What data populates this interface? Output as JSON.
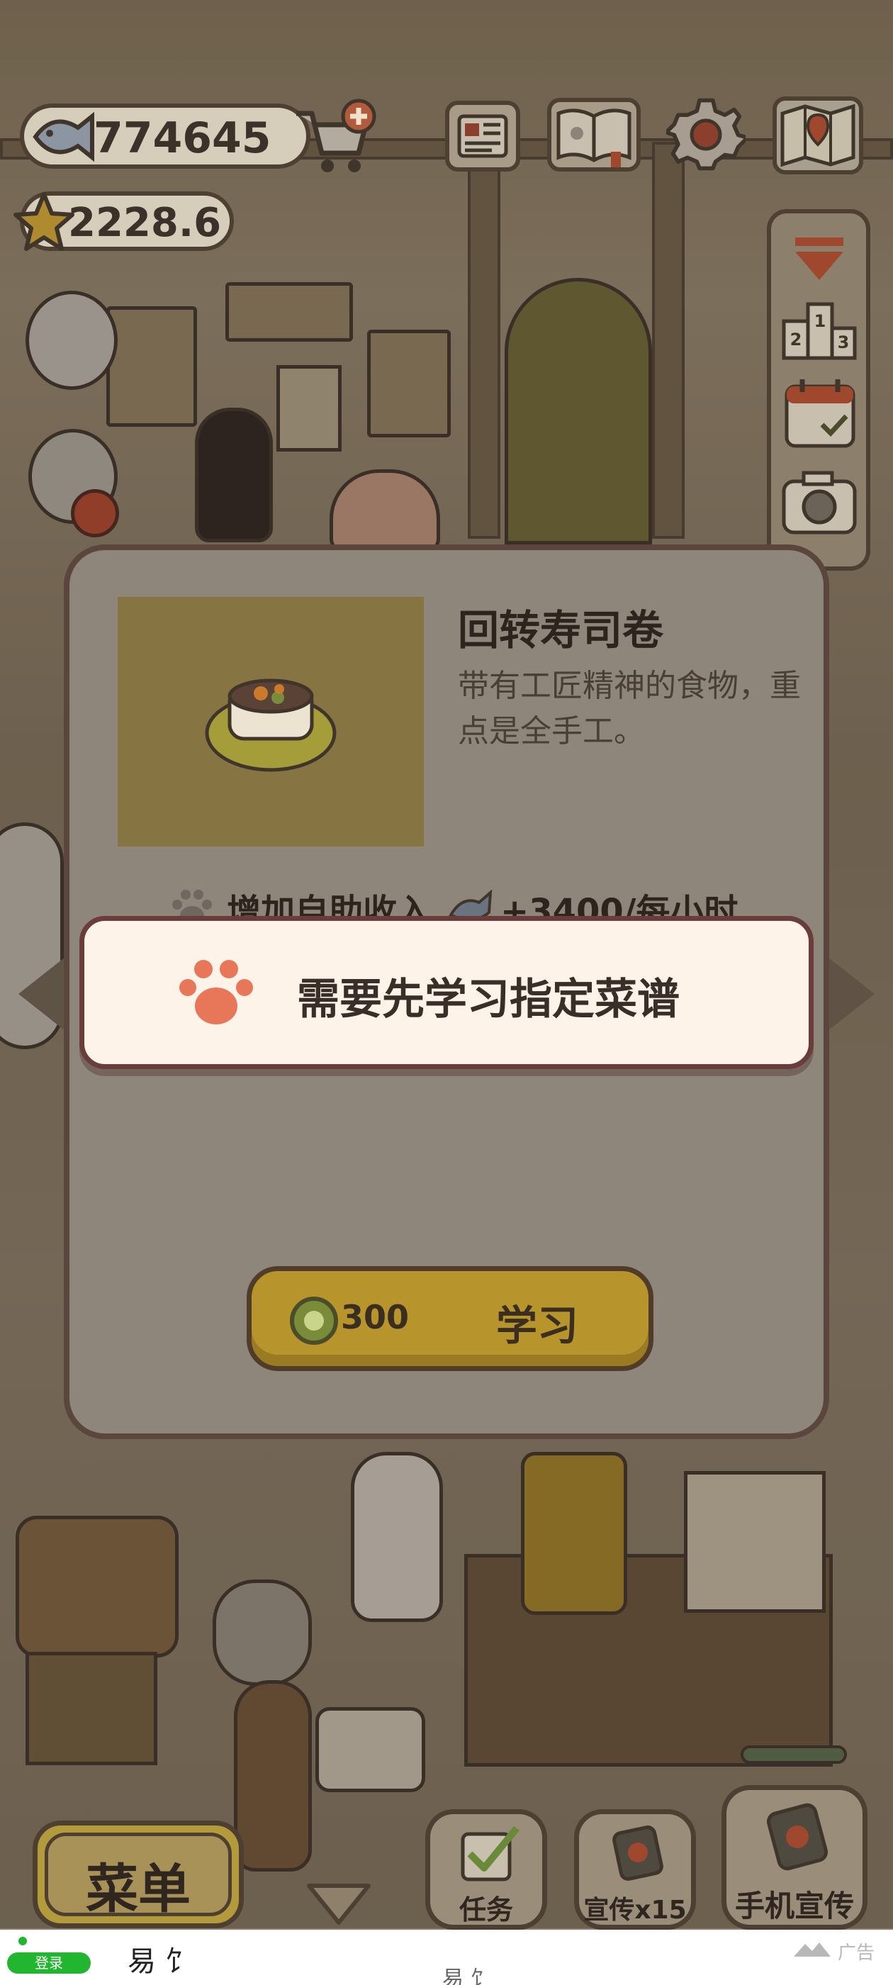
{
  "hud": {
    "fish": "774645",
    "stars": "2228.6",
    "icons": [
      "fish-icon",
      "cart-plus-icon",
      "newspaper-icon",
      "recipe-book-icon",
      "gear-icon",
      "map-icon",
      "star-icon"
    ],
    "side_icons": [
      "chevron-down-icon",
      "podium-icon",
      "calendar-icon",
      "camera-icon"
    ]
  },
  "dialog": {
    "dish_name": "回转寿司卷",
    "description": "带有工匠精神的食物，重点是全手工。",
    "income_label": "增加自助收入",
    "income_value": "+3400/每小时",
    "cost": "300",
    "learn_label": "学习"
  },
  "toast": {
    "message": "需要先学习指定菜谱"
  },
  "bottom": {
    "menu_label": "菜单",
    "task_label": "任务",
    "promo_label": "宣传x15",
    "phone_promo_label": "手机宣传"
  },
  "ad": {
    "login_label": "登录",
    "brand": "易 饣",
    "brand_sub": "易 饣",
    "tag": "广告"
  },
  "colors": {
    "toast_bg": "#fdf3e8",
    "paw": "#e8775a",
    "button_gold": "#b7942c",
    "ad_login_green": "#22b530"
  }
}
